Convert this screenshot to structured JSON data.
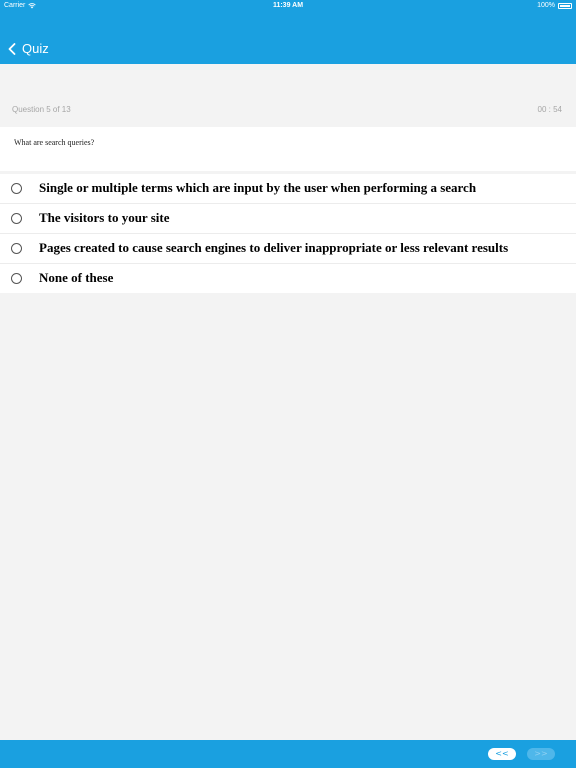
{
  "status_bar": {
    "carrier": "Carrier",
    "time": "11:39 AM",
    "battery": "100%",
    "battery_level": 1.0,
    "icons": [
      "wifi-icon",
      "battery-icon"
    ]
  },
  "nav": {
    "title": "Quiz",
    "back_icon": "chevron-left-icon"
  },
  "quiz": {
    "counter": "Question 5 of 13",
    "timer": "00 : 54",
    "question": "What are search queries?",
    "options": [
      {
        "label": "Single or multiple terms which are input by the user when performing a search"
      },
      {
        "label": "The visitors to your site"
      },
      {
        "label": "Pages created to cause search engines to deliver inappropriate or less relevant results"
      },
      {
        "label": "None of these"
      }
    ]
  },
  "pager": {
    "prev_label": "<<",
    "next_label": ">>"
  },
  "colors": {
    "accent": "#1aa0e0",
    "background": "#f3f3f3"
  }
}
